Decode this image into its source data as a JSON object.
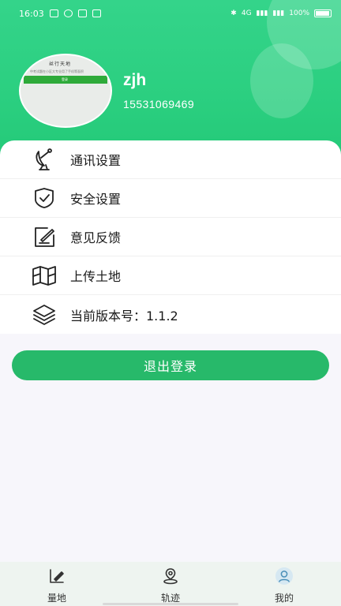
{
  "status_bar": {
    "time": "16:03",
    "network": "4G",
    "battery_text": "100%"
  },
  "profile": {
    "username": "zjh",
    "phone": "15531069469",
    "avatar": {
      "title": "丝行天地",
      "caption": "中考试题在小区大专业用了手机等面积",
      "button_text": "登录"
    }
  },
  "menu": {
    "items": [
      {
        "label": "通讯设置",
        "icon": "satellite-dish-icon"
      },
      {
        "label": "安全设置",
        "icon": "shield-check-icon"
      },
      {
        "label": "意见反馈",
        "icon": "feedback-edit-icon"
      },
      {
        "label": "上传土地",
        "icon": "map-fold-icon"
      },
      {
        "label": "当前版本号：1.1.2",
        "icon": "layers-icon"
      }
    ]
  },
  "logout_label": "退出登录",
  "tabbar": {
    "tabs": [
      {
        "label": "量地",
        "icon": "measure-pen-icon"
      },
      {
        "label": "轨迹",
        "icon": "location-pin-icon"
      },
      {
        "label": "我的",
        "icon": "user-avatar-icon",
        "active": true
      }
    ]
  },
  "colors": {
    "header_green": "#2bcf80",
    "button_green": "#27b96a",
    "page_bg": "#f7f6fb"
  }
}
